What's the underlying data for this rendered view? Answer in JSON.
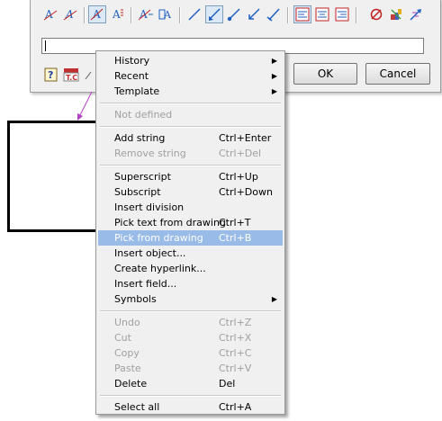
{
  "toolbar": {
    "icons": [
      "text-style-a-icon",
      "italic-a-icon",
      "align-a-icon",
      "stacked-a-icon",
      "text-edit-icon",
      "text-frame-icon",
      "line-icon",
      "leader-arrow-icon",
      "leader-dot-icon",
      "leader-arrow-left-icon",
      "leader-slash-icon",
      "align-left-icon",
      "align-center-icon",
      "align-right-icon",
      "no-symbol-icon",
      "paint-icon",
      "arrow-sparkle-icon"
    ]
  },
  "dialog": {
    "text_value": "",
    "ok_label": "OK",
    "cancel_label": "Cancel"
  },
  "menu": {
    "history": "History",
    "recent": "Recent",
    "template": "Template",
    "not_defined": "Not defined",
    "add_string": "Add string",
    "add_string_sc": "Ctrl+Enter",
    "remove_string": "Remove string",
    "remove_string_sc": "Ctrl+Del",
    "superscript": "Superscript",
    "superscript_sc": "Ctrl+Up",
    "subscript": "Subscript",
    "subscript_sc": "Ctrl+Down",
    "insert_division": "Insert division",
    "pick_text": "Pick text from drawing",
    "pick_text_sc": "Ctrl+T",
    "pick_from": "Pick from drawing",
    "pick_from_sc": "Ctrl+B",
    "insert_object": "Insert object...",
    "create_hyperlink": "Create hyperlink...",
    "insert_field": "Insert field...",
    "symbols": "Symbols",
    "undo": "Undo",
    "undo_sc": "Ctrl+Z",
    "cut": "Cut",
    "cut_sc": "Ctrl+X",
    "copy": "Copy",
    "copy_sc": "Ctrl+C",
    "paste": "Paste",
    "paste_sc": "Ctrl+V",
    "delete": "Delete",
    "delete_sc": "Del",
    "select_all": "Select all",
    "select_all_sc": "Ctrl+A"
  },
  "colors": {
    "highlight": "#99bbe8",
    "accent_blue": "#1f5fbf",
    "leader_magenta": "#b040c0"
  }
}
